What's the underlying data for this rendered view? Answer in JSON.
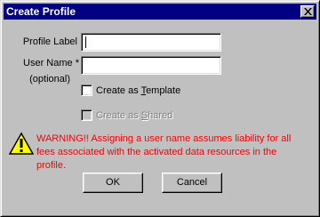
{
  "window": {
    "title": "Create Profile"
  },
  "form": {
    "profile_label": "Profile Label",
    "profile_value": "",
    "user_name_label": "User Name *",
    "user_name_note": "(optional)",
    "user_name_value": ""
  },
  "options": {
    "template": {
      "prefix": "Create as ",
      "accel": "T",
      "rest": "emplate",
      "checked": false
    },
    "shared": {
      "prefix": "Create as ",
      "accel": "S",
      "rest": "hared",
      "checked": false,
      "disabled": true
    }
  },
  "warning": {
    "icon": "warning-triangle-icon",
    "text": "WARNING!! Assigning a user name assumes liability for all fees associated with the activated data resources in the profile.",
    "color": "#ff0000"
  },
  "buttons": {
    "ok": "OK",
    "cancel": "Cancel"
  },
  "colors": {
    "titlebar": "#000080",
    "face": "#c0c0c0"
  }
}
